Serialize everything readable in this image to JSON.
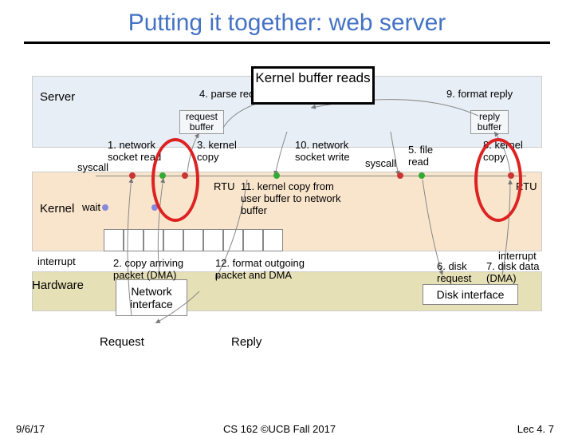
{
  "title": "Putting it together: web server",
  "kernel_box": "Kernel buffer reads",
  "layers": {
    "server": "Server",
    "kernel": "Kernel",
    "hardware": "Hardware"
  },
  "buffers": {
    "request": "request buffer",
    "reply": "reply buffer"
  },
  "steps": {
    "s1": "1. network socket read",
    "s2": "2. copy arriving packet (DMA)",
    "s3": "3. kernel copy",
    "s4": "4. parse request",
    "s5": "5. file read",
    "s6": "6. disk request",
    "s7": "7. disk data (DMA)",
    "s8": "8. kernel copy",
    "s9": "9. format reply",
    "s10": "10. network socket write",
    "s11": "11. kernel copy from user buffer to network buffer",
    "s12": "12. format outgoing packet and DMA"
  },
  "annotations": {
    "syscall": "syscall",
    "wait": "wait",
    "rtu": "RTU",
    "interrupt": "interrupt",
    "ni": "Network interface",
    "disk": "Disk interface"
  },
  "bottom": {
    "request": "Request",
    "reply": "Reply"
  },
  "footer": {
    "date": "9/6/17",
    "center": "CS 162 ©UCB Fall 2017",
    "right": "Lec 4. 7"
  }
}
